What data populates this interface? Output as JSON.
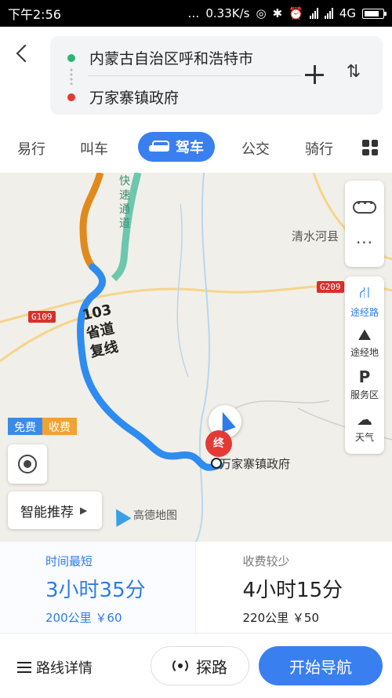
{
  "status_bar": {
    "time": "下午2:56",
    "speed": "0.33K/s",
    "network": "4G",
    "icons": [
      "dots-icon",
      "hotspot-icon",
      "bluetooth-icon",
      "alarm-icon",
      "signal-icon",
      "signal-icon",
      "battery-icon"
    ]
  },
  "route": {
    "from": "内蒙古自治区呼和浩特市",
    "to": "万家寨镇政府",
    "from_color": "#2bb673",
    "to_color": "#e53935"
  },
  "tabs": {
    "walk": "易行",
    "taxi": "叫车",
    "drive": "驾车",
    "bus": "公交",
    "bike": "骑行"
  },
  "map": {
    "labels": {
      "county": "清水河县",
      "road_g109": "G109",
      "road_g209": "G209",
      "road_name": "103省道复线",
      "expressway": "快速通道",
      "destination": "万家寨镇政府",
      "dest_marker": "终",
      "logo": "高德地图"
    },
    "tools": {
      "route_points": "途经路",
      "via_place": "途经地",
      "service": "服务区",
      "weather": "天气"
    },
    "toggle": {
      "free": "免费",
      "toll": "收费"
    },
    "smart_recommend": "智能推荐"
  },
  "cards": [
    {
      "tag": "时间最短",
      "time": "3小时35分",
      "meta": "200公里 ￥60"
    },
    {
      "tag": "收费较少",
      "time": "4小时15分",
      "meta": "220公里 ￥50"
    }
  ],
  "bottom": {
    "detail": "路线详情",
    "probe": "探路",
    "start": "开始导航"
  },
  "colors": {
    "accent": "#3a7ff0",
    "route_blue": "#2e8cf0",
    "route_orange": "#e08a1e",
    "route_teal": "#6cc7ad"
  }
}
